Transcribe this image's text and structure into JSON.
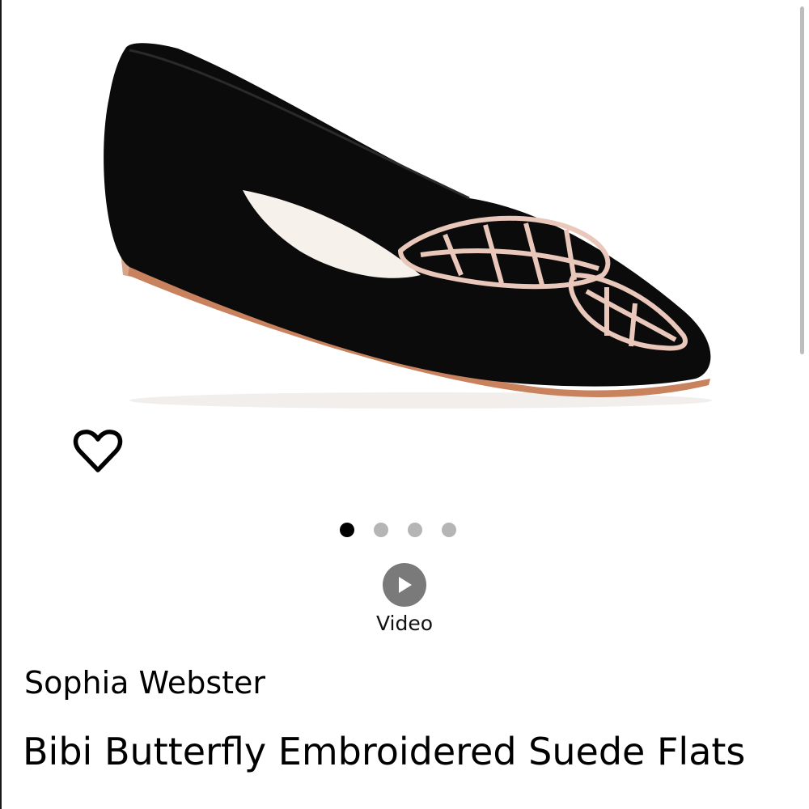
{
  "product": {
    "brand": "Sophia Webster",
    "name": "Bibi Butterfly Embroidered Suede Flats"
  },
  "gallery": {
    "image_count": 4,
    "active_index": 0
  },
  "video": {
    "label": "Video"
  },
  "icons": {
    "wishlist": "heart-outline-icon",
    "video": "play-icon"
  },
  "colors": {
    "active_dot": "#000000",
    "inactive_dot": "#b5b5b5",
    "shoe_suede": "#0b0b0b",
    "embroidery": "#e9c7bb"
  }
}
